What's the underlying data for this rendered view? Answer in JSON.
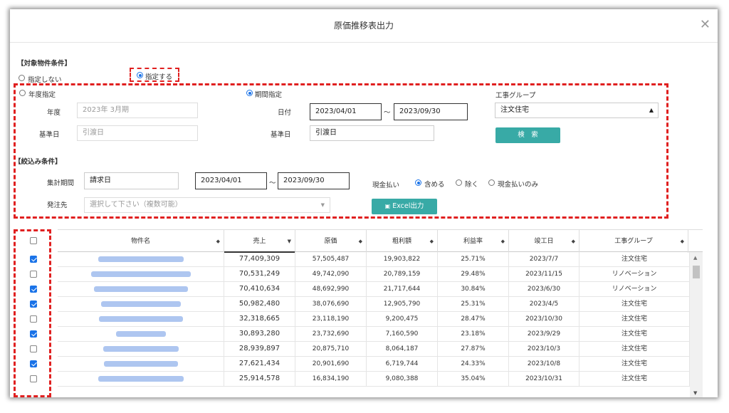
{
  "dialog": {
    "title": "原価推移表出力",
    "close": "✕"
  },
  "target": {
    "section_label": "【対象物件条件】",
    "opt_none": "指定しない",
    "opt_specify": "指定する",
    "opt_year": "年度指定",
    "year_label": "年度",
    "year_value": "2023年 3月期",
    "base_date_label": "基準日",
    "base_date_value": "引渡日",
    "opt_period": "期間指定",
    "date_label": "日付",
    "date_from": "2023/04/01",
    "tilde": "～",
    "date_to": "2023/09/30",
    "base_date2_label": "基準日",
    "base_date2_value": "引渡日",
    "group_label": "工事グループ",
    "group_value": "注文住宅",
    "search_button": "検　索"
  },
  "filter": {
    "section_label": "【絞込み条件】",
    "agg_label": "集計期間",
    "agg_value": "請求日",
    "agg_from": "2023/04/01",
    "tilde": "～",
    "agg_to": "2023/09/30",
    "cash_label": "現金払い",
    "cash_include": "含める",
    "cash_exclude": "除く",
    "cash_only": "現金払いのみ",
    "vendor_label": "発注先",
    "vendor_placeholder": "選択して下さい（複数可能）",
    "excel_button": "Excel出力"
  },
  "table": {
    "headers": [
      "物件名",
      "売上",
      "原価",
      "粗利額",
      "利益率",
      "竣工日",
      "工事グループ"
    ],
    "rows": [
      {
        "checked": true,
        "sales": "77,409,309",
        "cost": "57,505,487",
        "gross": "19,903,822",
        "rate": "25.71%",
        "date": "2023/7/7",
        "group": "注文住宅"
      },
      {
        "checked": false,
        "sales": "70,531,249",
        "cost": "49,742,090",
        "gross": "20,789,159",
        "rate": "29.48%",
        "date": "2023/11/15",
        "group": "リノベーション"
      },
      {
        "checked": true,
        "sales": "70,410,634",
        "cost": "48,692,990",
        "gross": "21,717,644",
        "rate": "30.84%",
        "date": "2023/6/30",
        "group": "リノベーション"
      },
      {
        "checked": true,
        "sales": "50,982,480",
        "cost": "38,076,690",
        "gross": "12,905,790",
        "rate": "25.31%",
        "date": "2023/4/5",
        "group": "注文住宅"
      },
      {
        "checked": false,
        "sales": "32,318,665",
        "cost": "23,118,190",
        "gross": "9,200,475",
        "rate": "28.47%",
        "date": "2023/10/30",
        "group": "注文住宅"
      },
      {
        "checked": true,
        "sales": "30,893,280",
        "cost": "23,732,690",
        "gross": "7,160,590",
        "rate": "23.18%",
        "date": "2023/9/29",
        "group": "注文住宅"
      },
      {
        "checked": false,
        "sales": "28,939,897",
        "cost": "20,875,710",
        "gross": "8,064,187",
        "rate": "27.87%",
        "date": "2023/10/3",
        "group": "注文住宅"
      },
      {
        "checked": true,
        "sales": "27,621,434",
        "cost": "20,901,690",
        "gross": "6,719,744",
        "rate": "24.33%",
        "date": "2023/10/8",
        "group": "注文住宅"
      },
      {
        "checked": false,
        "sales": "25,914,578",
        "cost": "16,834,190",
        "gross": "9,080,388",
        "rate": "35.04%",
        "date": "2023/10/31",
        "group": "注文住宅"
      }
    ]
  }
}
